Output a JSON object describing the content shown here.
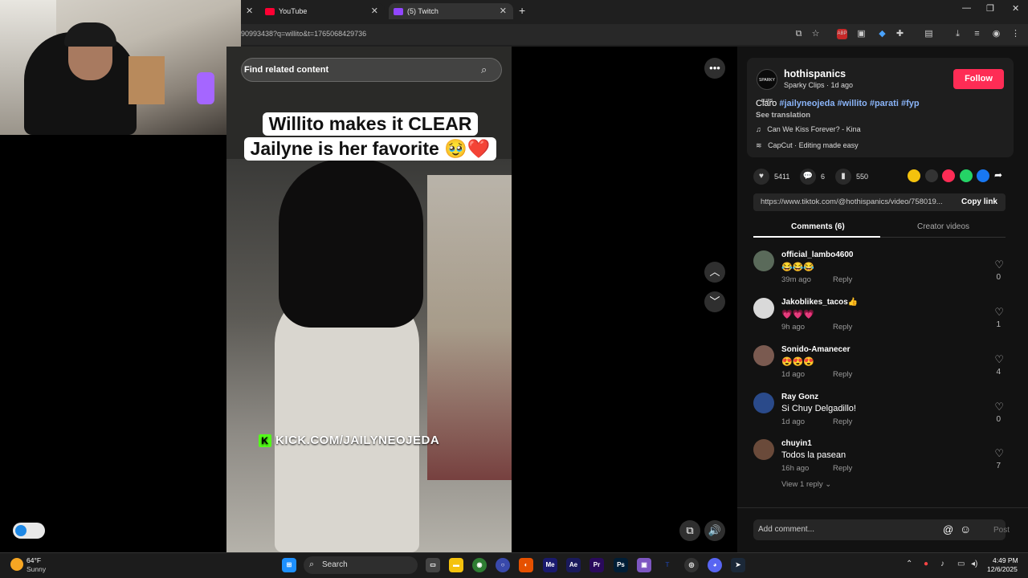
{
  "browser": {
    "tabs": [
      {
        "label": "YouTube"
      },
      {
        "label": "(5) Twitch"
      }
    ],
    "url_fragment": "90993438?q=willito&t=1765068429736",
    "new_tab_label": "+"
  },
  "video": {
    "search_placeholder": "Find related content",
    "caption_line1": "Willito makes it CLEAR",
    "caption_line2": "Jailyne is her favorite 🥹❤️",
    "watermark": "KICK.COM/JAILYNEOJEDA"
  },
  "post": {
    "avatar_text": "SPARKY CLIPS",
    "author": "hothispanics",
    "meta": "Sparky Clips · 1d ago",
    "follow_label": "Follow",
    "desc_lead": "Claro ",
    "hashtags": "#jailyneojeda #willito #parati #fyp",
    "see_translation": "See translation",
    "music": "Can We Kiss Forever? - Kina",
    "capcut": "CapCut · Editing made easy",
    "likes": "5411",
    "comments_count": "6",
    "saves": "550",
    "link": "https://www.tiktok.com/@hothispanics/video/758019...",
    "copy_link": "Copy link",
    "tab_comments": "Comments (6)",
    "tab_creator": "Creator videos"
  },
  "comments": [
    {
      "user": "official_lambo4600",
      "text": "😂😂😂",
      "time": "39m ago",
      "reply": "Reply",
      "likes": "0",
      "avatar_color": "#5a6a5a"
    },
    {
      "user": "Jakoblikes_tacos👍",
      "text": "💗💗💗",
      "time": "9h ago",
      "reply": "Reply",
      "likes": "1",
      "avatar_color": "#d9d9d9"
    },
    {
      "user": "Sonido-Amanecer",
      "text": "😍😍😍",
      "time": "1d ago",
      "reply": "Reply",
      "likes": "4",
      "avatar_color": "#7a5a50"
    },
    {
      "user": "Ray Gonz",
      "text": "Si Chuy Delgadillo!",
      "time": "1d ago",
      "reply": "Reply",
      "likes": "0",
      "avatar_color": "#2a4a8a"
    },
    {
      "user": "chuyin1",
      "text": "Todos la pasean",
      "time": "16h ago",
      "reply": "Reply",
      "likes": "7",
      "avatar_color": "#6a4a3a"
    }
  ],
  "view_reply": "View 1 reply ⌄",
  "add_comment_placeholder": "Add comment...",
  "post_label": "Post",
  "taskbar": {
    "weather_temp": "64°F",
    "weather_desc": "Sunny",
    "search_label": "Search",
    "time": "4:49 PM",
    "date": "12/6/2025"
  },
  "colors": {
    "follow": "#fe2c55",
    "hashtag": "#8ab4f8",
    "kick_green": "#53fc18"
  }
}
